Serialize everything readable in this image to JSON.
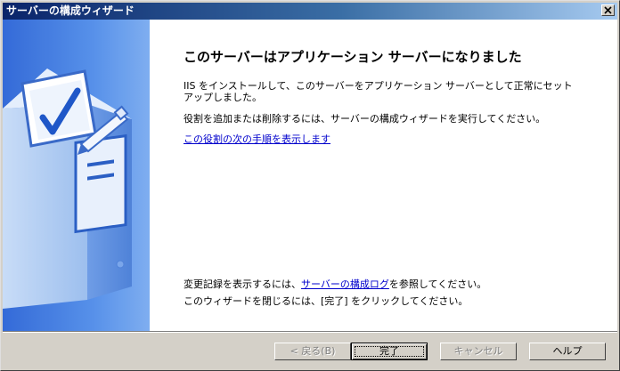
{
  "window": {
    "title": "サーバーの構成ウィザード"
  },
  "main": {
    "heading": "このサーバーはアプリケーション サーバーになりました",
    "paragraph1": "IIS をインストールして、このサーバーをアプリケーション サーバーとして正常にセットアップしました。",
    "paragraph2": "役割を追加または削除するには、サーバーの構成ウィザードを実行してください。",
    "next_steps_link": "この役割の次の手順を表示します",
    "log_prefix": "変更記録を表示するには、",
    "log_link": "サーバーの構成ログ",
    "log_suffix": "を参照してください。",
    "close_instruction": "このウィザードを閉じるには、[完了] をクリックしてください。"
  },
  "buttons": {
    "back": "< 戻る(B)",
    "finish": "完了",
    "cancel": "キャンセル",
    "help": "ヘルプ"
  },
  "icons": {
    "close": "close-icon",
    "illustration": "checklist-server-illustration"
  },
  "colors": {
    "title_start": "#0a246a",
    "title_end": "#a6caf0",
    "panel_blue": "#3f7fe0",
    "link": "#0000cc"
  }
}
